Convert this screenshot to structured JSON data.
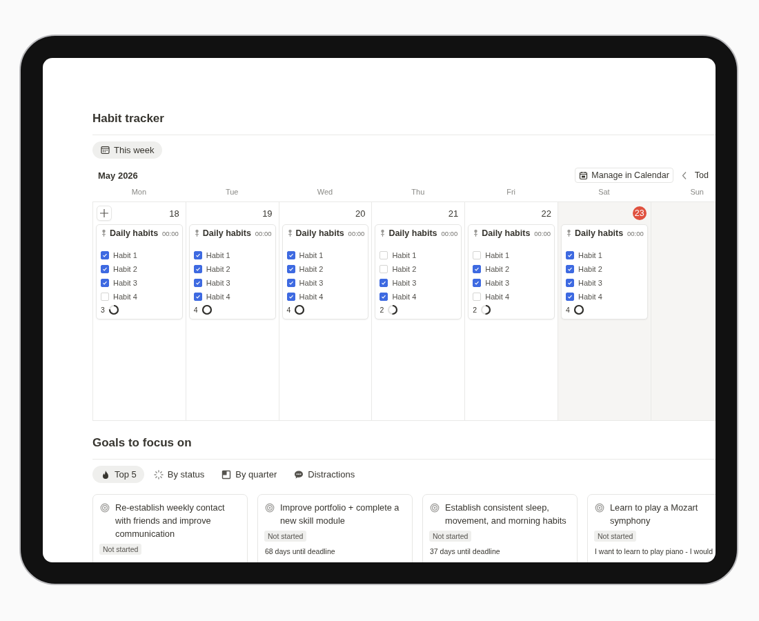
{
  "habit_tracker": {
    "title": "Habit tracker",
    "view_tab": {
      "label": "This week",
      "selected": true
    },
    "month": "May 2026",
    "manage_button": "Manage in Calendar",
    "today_button": "Tod",
    "days": [
      {
        "weekday": "Mon",
        "date": "18",
        "today": false,
        "weekend": false,
        "add_button": true,
        "event": {
          "title": "Daily habits",
          "time": "00:00",
          "habits": [
            {
              "label": "Habit 1",
              "checked": true
            },
            {
              "label": "Habit 2",
              "checked": true
            },
            {
              "label": "Habit 3",
              "checked": true
            },
            {
              "label": "Habit 4",
              "checked": false
            }
          ],
          "count": "3"
        }
      },
      {
        "weekday": "Tue",
        "date": "19",
        "today": false,
        "weekend": false,
        "event": {
          "title": "Daily habits",
          "time": "00:00",
          "habits": [
            {
              "label": "Habit 1",
              "checked": true
            },
            {
              "label": "Habit 2",
              "checked": true
            },
            {
              "label": "Habit 3",
              "checked": true
            },
            {
              "label": "Habit 4",
              "checked": true
            }
          ],
          "count": "4"
        }
      },
      {
        "weekday": "Wed",
        "date": "20",
        "today": false,
        "weekend": false,
        "event": {
          "title": "Daily habits",
          "time": "00:00",
          "habits": [
            {
              "label": "Habit 1",
              "checked": true
            },
            {
              "label": "Habit 2",
              "checked": true
            },
            {
              "label": "Habit 3",
              "checked": true
            },
            {
              "label": "Habit 4",
              "checked": true
            }
          ],
          "count": "4"
        }
      },
      {
        "weekday": "Thu",
        "date": "21",
        "today": false,
        "weekend": false,
        "event": {
          "title": "Daily habits",
          "time": "00:00",
          "habits": [
            {
              "label": "Habit 1",
              "checked": false
            },
            {
              "label": "Habit 2",
              "checked": false
            },
            {
              "label": "Habit 3",
              "checked": true
            },
            {
              "label": "Habit 4",
              "checked": true
            }
          ],
          "count": "2"
        }
      },
      {
        "weekday": "Fri",
        "date": "22",
        "today": false,
        "weekend": false,
        "event": {
          "title": "Daily habits",
          "time": "00:00",
          "habits": [
            {
              "label": "Habit 1",
              "checked": false
            },
            {
              "label": "Habit 2",
              "checked": true
            },
            {
              "label": "Habit 3",
              "checked": true
            },
            {
              "label": "Habit 4",
              "checked": false
            }
          ],
          "count": "2"
        }
      },
      {
        "weekday": "Sat",
        "date": "23",
        "today": true,
        "weekend": true,
        "event": {
          "title": "Daily habits",
          "time": "00:00",
          "habits": [
            {
              "label": "Habit 1",
              "checked": true
            },
            {
              "label": "Habit 2",
              "checked": true
            },
            {
              "label": "Habit 3",
              "checked": true
            },
            {
              "label": "Habit 4",
              "checked": true
            }
          ],
          "count": "4"
        }
      },
      {
        "weekday": "Sun",
        "weekend": true
      }
    ]
  },
  "goals": {
    "title": "Goals to focus on",
    "tabs": [
      {
        "label": "Top 5",
        "selected": true
      },
      {
        "label": "By status",
        "selected": false
      },
      {
        "label": "By quarter",
        "selected": false
      },
      {
        "label": "Distractions",
        "selected": false
      }
    ],
    "cards": [
      {
        "title": "Re-establish weekly contact with friends and improve communication",
        "status": "Not started"
      },
      {
        "title": "Improve portfolio + complete a new skill module",
        "status": "Not started",
        "detail": "68 days until deadline"
      },
      {
        "title": "Establish consistent sleep, movement, and morning habits",
        "status": "Not started",
        "detail": "37 days until deadline"
      },
      {
        "title": "Learn to play a Mozart symphony",
        "status": "Not started",
        "detail": "I want to learn to play piano - I would"
      }
    ]
  }
}
